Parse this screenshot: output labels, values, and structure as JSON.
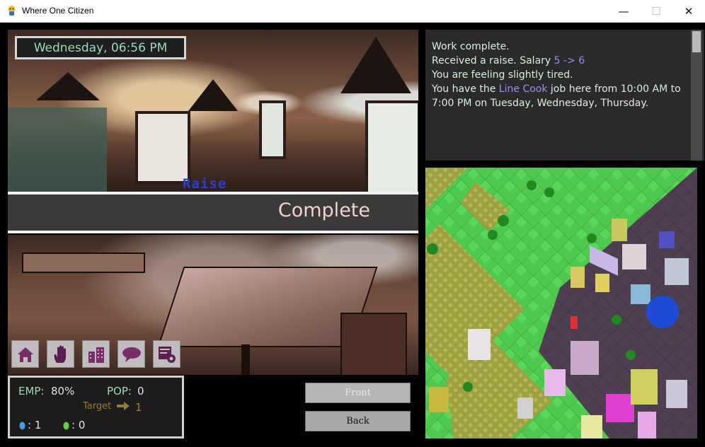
{
  "window": {
    "title": "Where One Citizen",
    "minimize": "—",
    "maximize": "☐",
    "close": "✕"
  },
  "clock": "Wednesday, 06:56 PM",
  "event": {
    "floating_label": "Raise",
    "status": "Complete"
  },
  "toolbar": [
    "home-icon",
    "hand-icon",
    "building-icon",
    "speech-icon",
    "settings-icon"
  ],
  "stats": {
    "emp_label": "EMP:",
    "emp_value": "80%",
    "pop_label": "POP:",
    "pop_value": "0",
    "target_label": "Target",
    "target_value": "1",
    "blue_count": ": 1",
    "green_count": ": 0"
  },
  "buttons": {
    "front": "Front",
    "back": "Back"
  },
  "log": {
    "line1": "Work complete.",
    "line2_pre": "Received a raise. Salary ",
    "line2_from": "5",
    "line2_arrow": " -> ",
    "line2_to": "6",
    "line3": "You are feeling slightly tired.",
    "line4_pre": "You have the ",
    "line4_job": "Line Cook",
    "line4_post": " job here from 10:00 AM to 7:00 PM on Tuesday, Wednesday, Thursday."
  },
  "colors": {
    "accent_text": "#9adbb6",
    "highlight": "#9a90f2",
    "complete_text": "#f2d2cc",
    "raise": "#2d3fc8"
  }
}
